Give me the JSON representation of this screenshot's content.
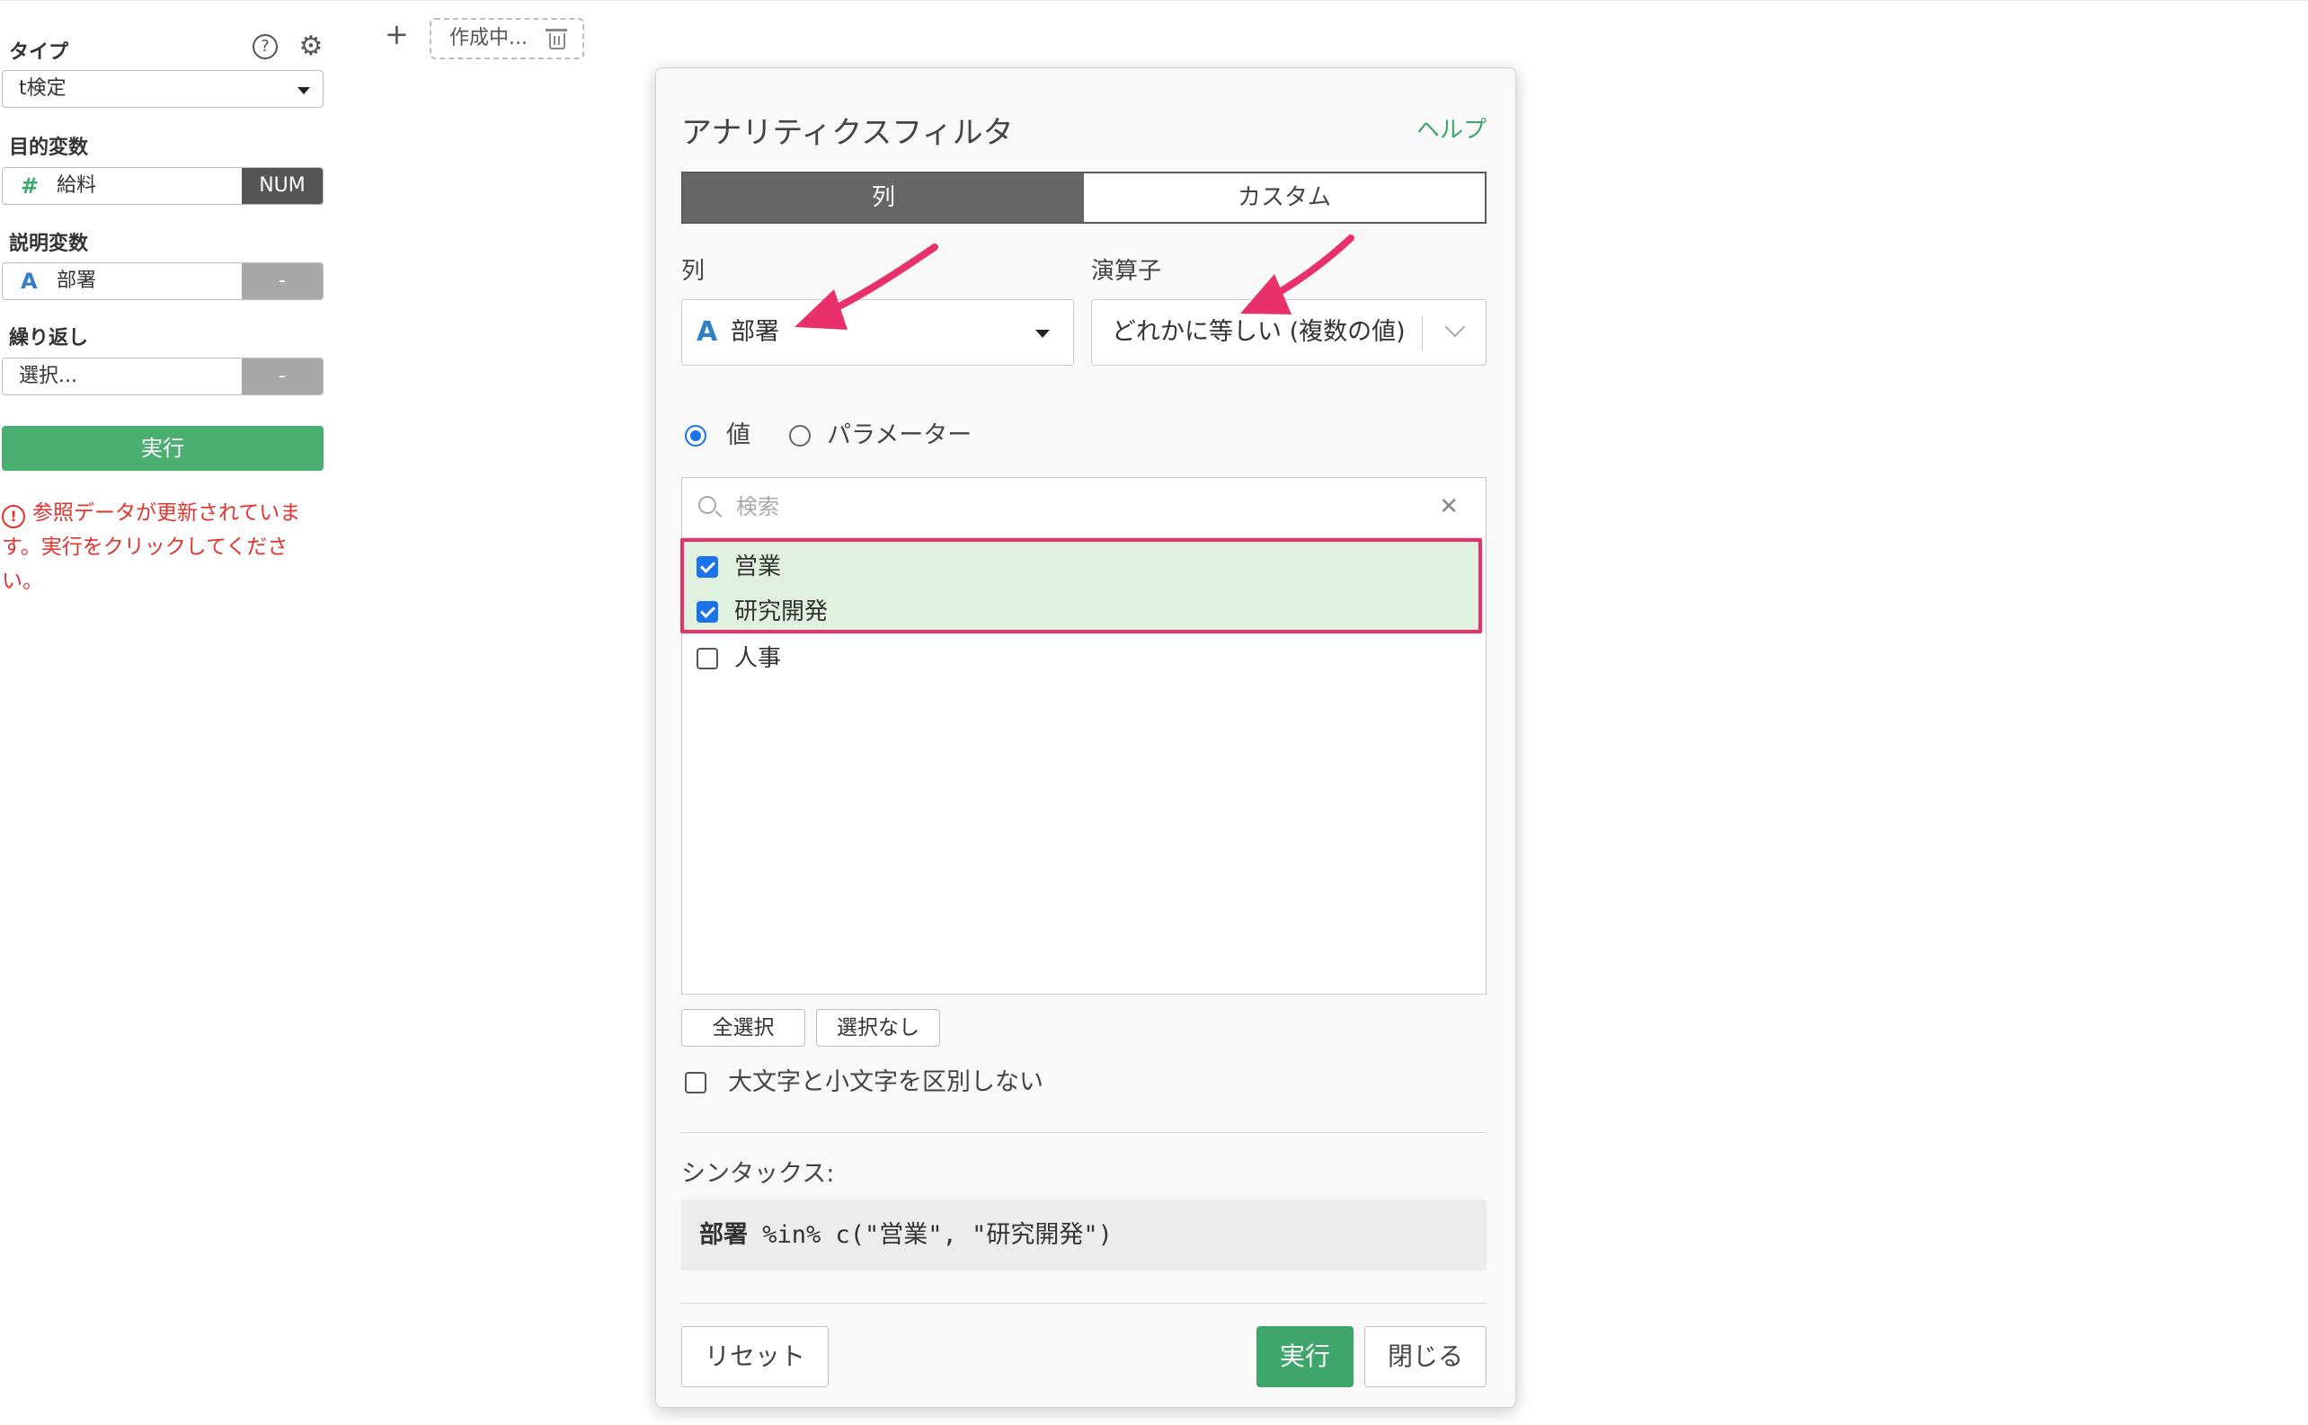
{
  "sidebar": {
    "type_label": "タイプ",
    "type_value": "t検定",
    "target_label": "目的変数",
    "target_field": {
      "icon": "#",
      "name": "給料",
      "badge": "NUM"
    },
    "explanatory_label": "説明変数",
    "explanatory_field": {
      "icon": "A",
      "name": "部署",
      "badge": "-"
    },
    "repeat_label": "繰り返し",
    "repeat_field": {
      "placeholder": "選択...",
      "badge": "-"
    },
    "run_label": "実行",
    "warning": "参照データが更新されています。実行をクリックしてください。"
  },
  "toolbar": {
    "add": "+",
    "draft_tab": "作成中..."
  },
  "dialog": {
    "title": "アナリティクスフィルタ",
    "help": "ヘルプ",
    "tabs": [
      "列",
      "カスタム"
    ],
    "column_label": "列",
    "column_icon": "A",
    "column_value": "部署",
    "operator_label": "演算子",
    "operator_value": "どれかに等しい (複数の値)",
    "radio_value": "値",
    "radio_parameter": "パラメーター",
    "search_placeholder": "検索",
    "items": [
      {
        "label": "営業",
        "checked": true
      },
      {
        "label": "研究開発",
        "checked": true
      },
      {
        "label": "人事",
        "checked": false
      }
    ],
    "select_all": "全選択",
    "select_none": "選択なし",
    "case_insensitive": "大文字と小文字を区別しない",
    "syntax_label": "シンタックス:",
    "syntax_col": "部署",
    "syntax_rest": " %in% c(\"営業\", \"研究開発\")",
    "reset": "リセット",
    "run": "実行",
    "close": "閉じる"
  },
  "colors": {
    "accent_green": "#3fa66b",
    "highlight_pink": "#e8306a",
    "checkbox_blue": "#1a73e8",
    "warning_red": "#e2342d"
  }
}
